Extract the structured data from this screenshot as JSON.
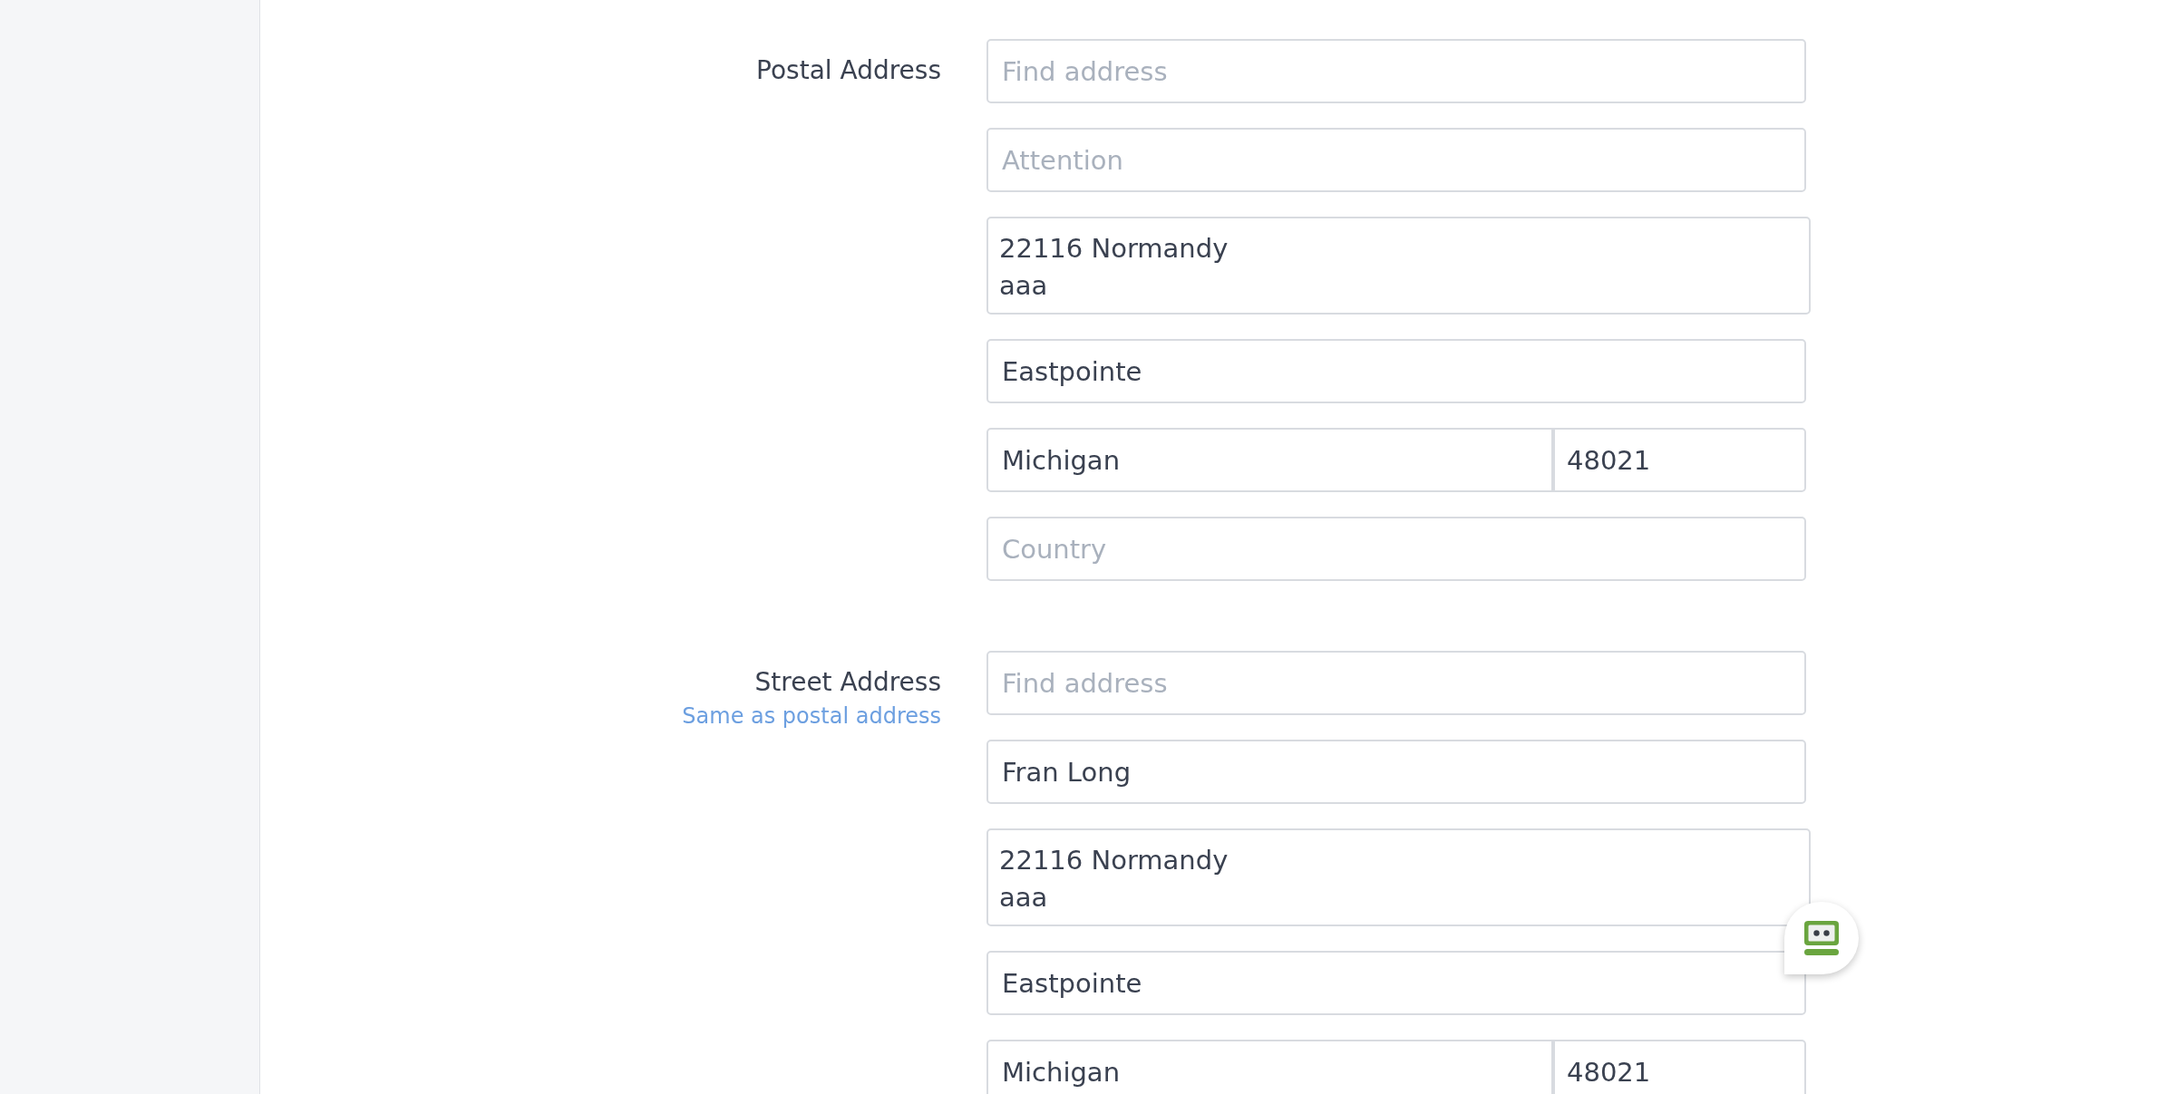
{
  "sections": [
    {
      "label": "Postal Address",
      "fields": [
        {
          "kind": "text",
          "placeholder": "Find address"
        },
        {
          "kind": "text",
          "placeholder": "Attention"
        },
        {
          "kind": "textarea",
          "value": "22116 Normandy\naaa"
        },
        {
          "kind": "text",
          "value": "Eastpointe"
        },
        {
          "kind": "pair",
          "fields": [
            {
              "value": "Michigan"
            },
            {
              "value": "48021"
            }
          ]
        },
        {
          "kind": "text",
          "placeholder": "Country"
        }
      ]
    },
    {
      "label": "Street Address",
      "link": "Same as postal address",
      "fields": [
        {
          "kind": "text",
          "placeholder": "Find address"
        },
        {
          "kind": "text",
          "value": "Fran Long"
        },
        {
          "kind": "textarea",
          "value": "22116 Normandy\naaa"
        },
        {
          "kind": "text",
          "value": "Eastpointe"
        },
        {
          "kind": "pair",
          "fields": [
            {
              "value": "Michigan"
            },
            {
              "value": "48021"
            }
          ]
        }
      ]
    }
  ]
}
